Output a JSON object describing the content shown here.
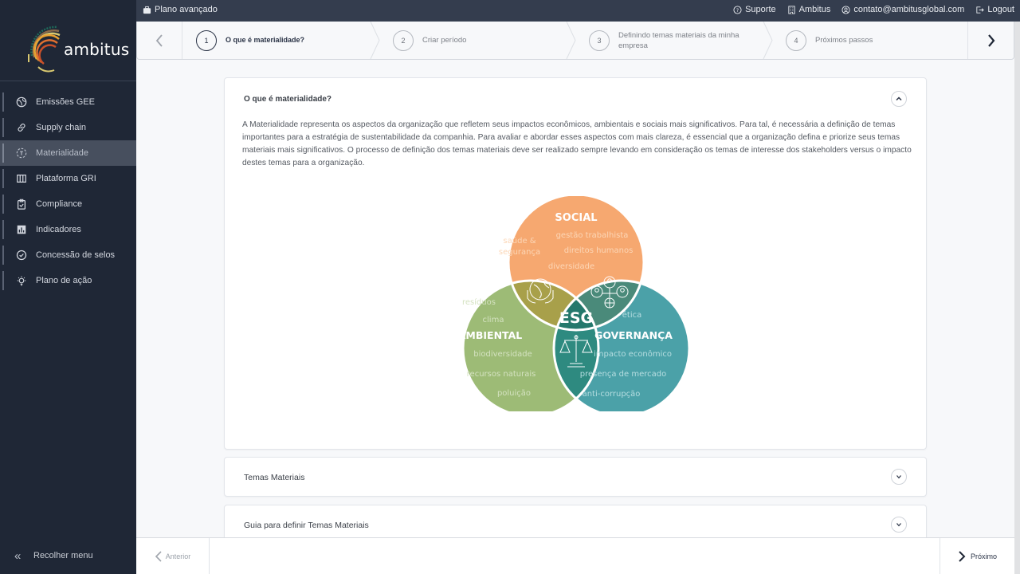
{
  "brand": {
    "name": "ambitus"
  },
  "topbar": {
    "plan": "Plano avançado",
    "links": [
      {
        "icon": "question-circle-icon",
        "label": "Suporte"
      },
      {
        "icon": "building-icon",
        "label": "Ambitus"
      },
      {
        "icon": "user-circle-icon",
        "label": "contato@ambitusglobal.com"
      },
      {
        "icon": "logout-icon",
        "label": "Logout"
      }
    ]
  },
  "sidebar": {
    "items": [
      {
        "label": "Emissões GEE",
        "icon": "globe-icon",
        "active": false
      },
      {
        "label": "Supply chain",
        "icon": "link-icon",
        "active": false
      },
      {
        "label": "Materialidade",
        "icon": "target-icon",
        "active": true
      },
      {
        "label": "Plataforma GRI",
        "icon": "columns-icon",
        "active": false
      },
      {
        "label": "Compliance",
        "icon": "clipboard-check-icon",
        "active": false
      },
      {
        "label": "Indicadores",
        "icon": "bar-chart-icon",
        "active": false
      },
      {
        "label": "Concessão de selos",
        "icon": "badge-check-icon",
        "active": false
      },
      {
        "label": "Plano de ação",
        "icon": "lightbulb-icon",
        "active": false
      }
    ],
    "collapse_label": "Recolher menu"
  },
  "stepper": {
    "steps": [
      {
        "num": "1",
        "label": "O que é materialidade?",
        "active": true
      },
      {
        "num": "2",
        "label": "Criar período",
        "active": false
      },
      {
        "num": "3",
        "label": "Definindo temas materiais da minha empresa",
        "active": false
      },
      {
        "num": "4",
        "label": "Próximos passos",
        "active": false
      }
    ]
  },
  "sections": [
    {
      "title": "O que é materialidade?",
      "expanded": true,
      "text": "A Materialidade representa os aspectos da organização que refletem seus impactos econômicos, ambientais e sociais mais significativos. Para tal, é necessária a definição de temas importantes para a estratégia de sustentabilidade da companhia. Para avaliar e abordar esses aspectos com mais clareza, é essencial que a organização defina e priorize seus temas materiais mais significativos. O processo de definição dos temas materiais deve ser realizado sempre levando em consideração os temas de interesse dos stakeholders versus o impacto destes temas para a organização."
    },
    {
      "title": "Temas Materiais",
      "expanded": false
    },
    {
      "title": "Guia para definir Temas Materiais",
      "expanded": false
    }
  ],
  "venn": {
    "center": "ESG",
    "social": {
      "title": "SOCIAL",
      "color": "#f6a870",
      "topics": [
        "gestão trabalhista",
        "saúde &",
        "segurança",
        "direitos humanos",
        "diversidade"
      ]
    },
    "ambiental": {
      "title": "AMBIENTAL",
      "color": "#9dbb76",
      "topics": [
        "resíduos",
        "clima",
        "biodiversidade",
        "recursos naturais",
        "poluição"
      ]
    },
    "governanca": {
      "title": "GOVERNANÇA",
      "color": "#4ba1a8",
      "topics": [
        "ética",
        "impacto econômico",
        "presença de mercado",
        "anti-corrupção"
      ]
    }
  },
  "footer": {
    "prev_label": "Anterior",
    "next_label": "Próximo"
  }
}
